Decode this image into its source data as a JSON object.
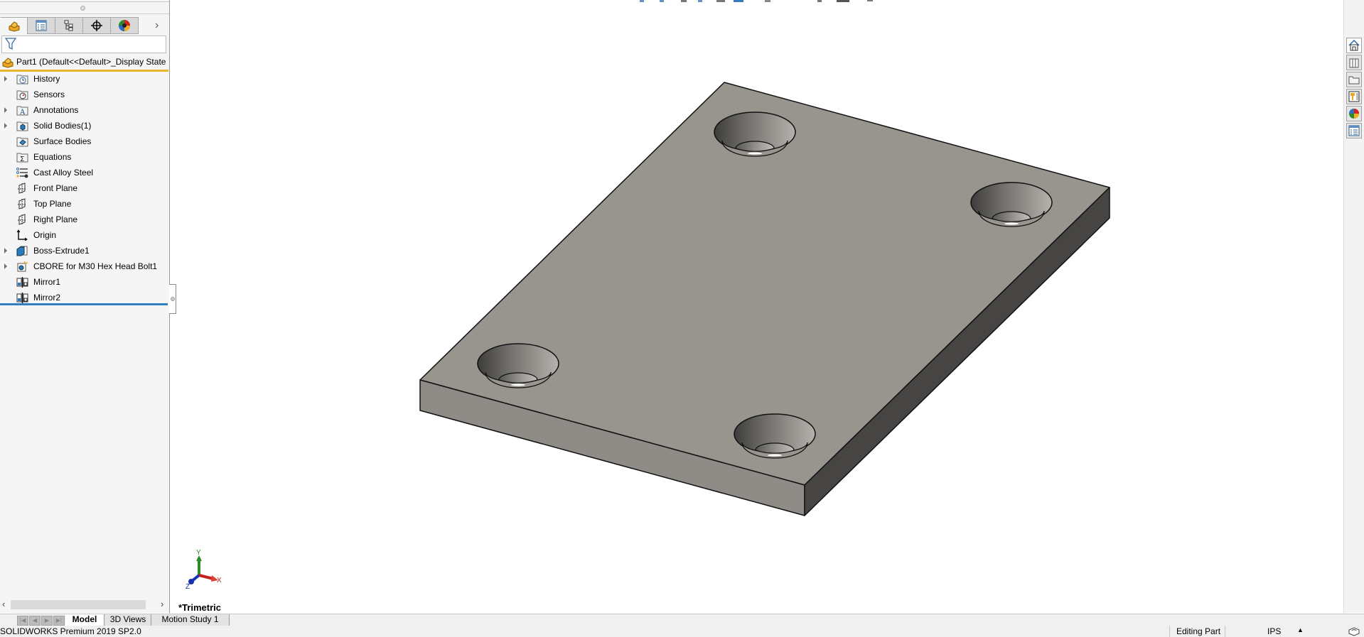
{
  "feature_manager": {
    "tabs": [
      {
        "name": "featuremanager-tab",
        "icon": "part-icon",
        "active": true
      },
      {
        "name": "propertymanager-tab",
        "icon": "property-list-icon",
        "active": false
      },
      {
        "name": "configurationmanager-tab",
        "icon": "configuration-tree-icon",
        "active": false
      },
      {
        "name": "dimxpert-tab",
        "icon": "crosshair-icon",
        "active": false
      },
      {
        "name": "displaymanager-tab",
        "icon": "appearance-ball-icon",
        "active": false
      }
    ],
    "more_tabs_glyph": "›",
    "filter_icon": "filter-funnel-icon",
    "part_label": "Part1  (Default<<Default>_Display State",
    "tree": [
      {
        "label": "History",
        "icon": "history-folder-icon",
        "expandable": true
      },
      {
        "label": "Sensors",
        "icon": "sensors-folder-icon",
        "expandable": false
      },
      {
        "label": "Annotations",
        "icon": "annotations-folder-icon",
        "expandable": true
      },
      {
        "label": "Solid Bodies(1)",
        "icon": "solid-bodies-folder-icon",
        "expandable": true
      },
      {
        "label": "Surface Bodies",
        "icon": "surface-bodies-folder-icon",
        "expandable": false
      },
      {
        "label": "Equations",
        "icon": "equations-folder-icon",
        "expandable": false
      },
      {
        "label": "Cast Alloy Steel",
        "icon": "material-icon",
        "expandable": false
      },
      {
        "label": "Front Plane",
        "icon": "plane-icon",
        "expandable": false
      },
      {
        "label": "Top Plane",
        "icon": "plane-icon",
        "expandable": false
      },
      {
        "label": "Right Plane",
        "icon": "plane-icon",
        "expandable": false
      },
      {
        "label": "Origin",
        "icon": "origin-icon",
        "expandable": false
      },
      {
        "label": "Boss-Extrude1",
        "icon": "boss-extrude-icon",
        "expandable": true
      },
      {
        "label": "CBORE for M30 Hex Head Bolt1",
        "icon": "hole-wizard-icon",
        "expandable": true
      },
      {
        "label": "Mirror1",
        "icon": "mirror-icon",
        "expandable": false
      },
      {
        "label": "Mirror2",
        "icon": "mirror-icon",
        "expandable": false
      }
    ]
  },
  "viewport": {
    "view_orientation": "*Trimetric",
    "triad": {
      "x": "X",
      "y": "Y",
      "z": "Z"
    },
    "model_colors": {
      "top_face": "#98958f",
      "front_face": "#8f8c87",
      "side_face": "#464544",
      "edge": "#111111"
    }
  },
  "bottom_tabs": [
    "Model",
    "3D Views",
    "Motion Study 1"
  ],
  "active_bottom_tab": "Model",
  "status_bar": {
    "product": "SOLIDWORKS Premium 2019 SP2.0",
    "mode": "Editing Part",
    "units": "IPS",
    "units_caret": "▲"
  },
  "task_pane": [
    {
      "name": "solidworks-resources-button",
      "icon": "home-icon"
    },
    {
      "name": "design-library-button",
      "icon": "design-library-icon"
    },
    {
      "name": "file-explorer-button",
      "icon": "folder-icon"
    },
    {
      "name": "view-palette-button",
      "icon": "view-palette-icon"
    },
    {
      "name": "appearances-button",
      "icon": "appearances-icon"
    },
    {
      "name": "custom-properties-button",
      "icon": "custom-properties-icon"
    }
  ]
}
